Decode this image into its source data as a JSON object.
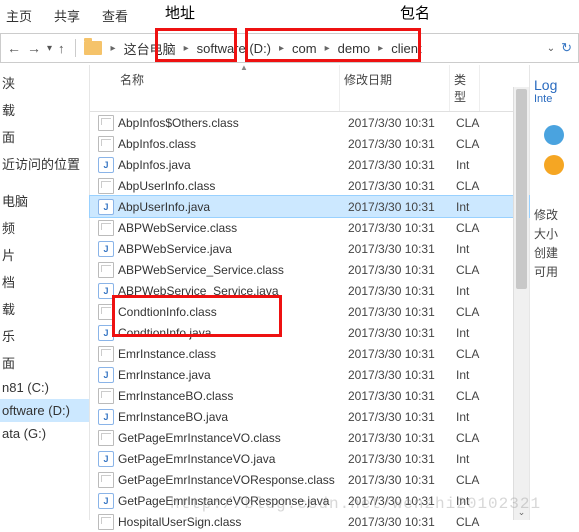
{
  "tabs": {
    "t1": "主页",
    "t2": "共享",
    "t3": "查看"
  },
  "annot": {
    "addr": "地址",
    "pkg": "包名"
  },
  "breadcrumb": {
    "c0": "这台电脑",
    "c1": "software (D:)",
    "c2": "com",
    "c3": "demo",
    "c4": "client"
  },
  "cols": {
    "name": "名称",
    "date": "修改日期",
    "type": "类型"
  },
  "sidebar": {
    "i0": "浃",
    "i1": "载",
    "i2": "面",
    "i3": "近访问的位置",
    "i4": "电脑",
    "i5": "频",
    "i6": "片",
    "i7": "档",
    "i8": "载",
    "i9": "乐",
    "i10": "面",
    "i11": "n81 (C:)",
    "i12": "oftware (D:)",
    "i13": "ata (G:)"
  },
  "files": [
    {
      "n": "AbpInfos$Others.class",
      "d": "2017/3/30 10:31",
      "t": "CLA",
      "k": "class"
    },
    {
      "n": "AbpInfos.class",
      "d": "2017/3/30 10:31",
      "t": "CLA",
      "k": "class"
    },
    {
      "n": "AbpInfos.java",
      "d": "2017/3/30 10:31",
      "t": "Int",
      "k": "java"
    },
    {
      "n": "AbpUserInfo.class",
      "d": "2017/3/30 10:31",
      "t": "CLA",
      "k": "class"
    },
    {
      "n": "AbpUserInfo.java",
      "d": "2017/3/30 10:31",
      "t": "Int",
      "k": "java",
      "sel": true
    },
    {
      "n": "ABPWebService.class",
      "d": "2017/3/30 10:31",
      "t": "CLA",
      "k": "class"
    },
    {
      "n": "ABPWebService.java",
      "d": "2017/3/30 10:31",
      "t": "Int",
      "k": "java"
    },
    {
      "n": "ABPWebService_Service.class",
      "d": "2017/3/30 10:31",
      "t": "CLA",
      "k": "class"
    },
    {
      "n": "ABPWebService_Service.java",
      "d": "2017/3/30 10:31",
      "t": "Int",
      "k": "java"
    },
    {
      "n": "CondtionInfo.class",
      "d": "2017/3/30 10:31",
      "t": "CLA",
      "k": "class"
    },
    {
      "n": "CondtionInfo.java",
      "d": "2017/3/30 10:31",
      "t": "Int",
      "k": "java"
    },
    {
      "n": "EmrInstance.class",
      "d": "2017/3/30 10:31",
      "t": "CLA",
      "k": "class"
    },
    {
      "n": "EmrInstance.java",
      "d": "2017/3/30 10:31",
      "t": "Int",
      "k": "java"
    },
    {
      "n": "EmrInstanceBO.class",
      "d": "2017/3/30 10:31",
      "t": "CLA",
      "k": "class"
    },
    {
      "n": "EmrInstanceBO.java",
      "d": "2017/3/30 10:31",
      "t": "Int",
      "k": "java"
    },
    {
      "n": "GetPageEmrInstanceVO.class",
      "d": "2017/3/30 10:31",
      "t": "CLA",
      "k": "class"
    },
    {
      "n": "GetPageEmrInstanceVO.java",
      "d": "2017/3/30 10:31",
      "t": "Int",
      "k": "java"
    },
    {
      "n": "GetPageEmrInstanceVOResponse.class",
      "d": "2017/3/30 10:31",
      "t": "CLA",
      "k": "class"
    },
    {
      "n": "GetPageEmrInstanceVOResponse.java",
      "d": "2017/3/30 10:31",
      "t": "Int",
      "k": "java"
    },
    {
      "n": "HospitalUserSign.class",
      "d": "2017/3/30 10:31",
      "t": "CLA",
      "k": "class"
    }
  ],
  "right": {
    "lo": "Log",
    "int": "Inte",
    "r1": "修改",
    "r2": "大小",
    "r3": "创建",
    "r4": "可用"
  },
  "watermark": "http://blog.csdn.net/wenzhi20102321"
}
